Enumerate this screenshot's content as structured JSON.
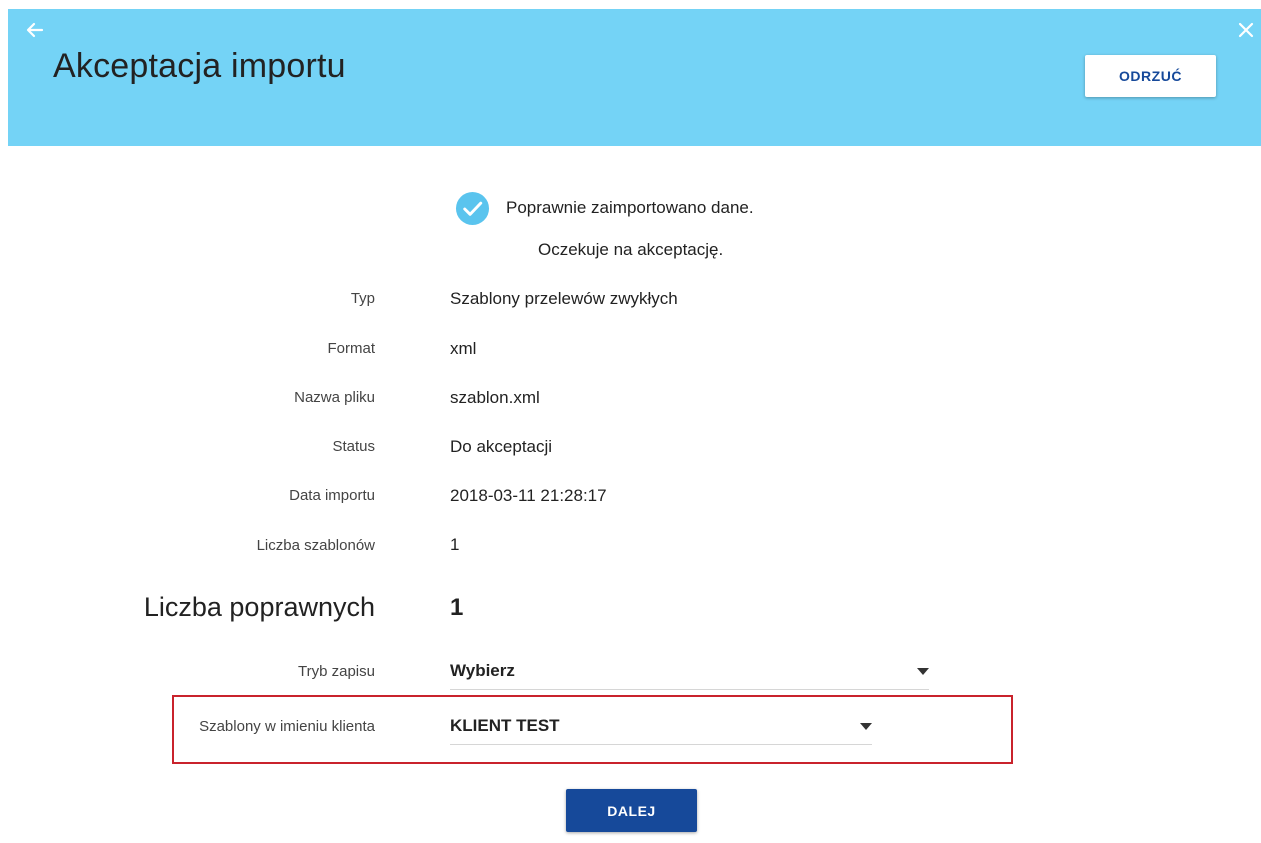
{
  "header": {
    "title": "Akceptacja importu",
    "reject_label": "ODRZUĆ",
    "background_color": "#74d3f6"
  },
  "status": {
    "success_message": "Poprawnie zaimportowano dane.",
    "pending_message": "Oczekuje na akceptację."
  },
  "details": [
    {
      "label": "Typ",
      "value": "Szablony przelewów zwykłych"
    },
    {
      "label": "Format",
      "value": "xml"
    },
    {
      "label": "Nazwa pliku",
      "value": "szablon.xml"
    },
    {
      "label": "Status",
      "value": "Do akceptacji"
    },
    {
      "label": "Data importu",
      "value": "2018-03-11 21:28:17"
    },
    {
      "label": "Liczba szablonów",
      "value": "1"
    }
  ],
  "correct_count": {
    "label": "Liczba poprawnych",
    "value": "1"
  },
  "save_mode": {
    "label": "Tryb zapisu",
    "selected": "Wybierz"
  },
  "client_templates": {
    "label": "Szablony w imieniu klienta",
    "selected": "KLIENT TEST"
  },
  "actions": {
    "next_label": "DALEJ",
    "primary_color": "#16499a",
    "highlight_color": "#c9232c"
  },
  "icons": {
    "back": "arrow-left-icon",
    "close": "close-icon",
    "success": "check-circle-icon",
    "dropdown": "caret-down-icon"
  }
}
